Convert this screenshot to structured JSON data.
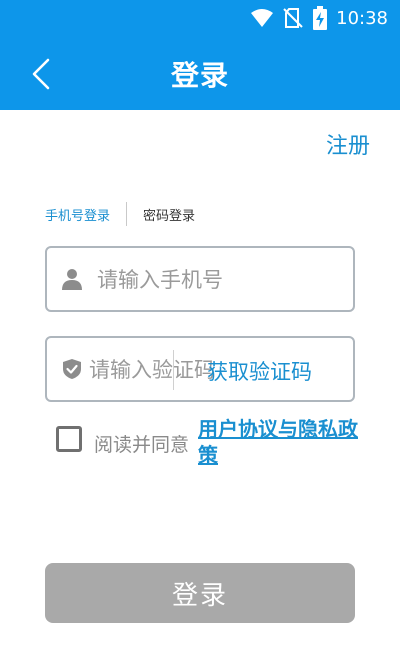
{
  "status_bar": {
    "time": "10:38",
    "icons": [
      "wifi-icon",
      "no-sim-icon",
      "battery-charging-icon"
    ]
  },
  "header": {
    "title": "登录",
    "back_icon": "chevron-left-icon"
  },
  "register_label": "注册",
  "tabs": [
    {
      "label": "手机号登录",
      "active": true
    },
    {
      "label": "密码登录",
      "active": false
    }
  ],
  "phone_field": {
    "placeholder": "请输入手机号",
    "value": "",
    "icon": "person-icon"
  },
  "code_field": {
    "placeholder": "请输入验证码",
    "value": "",
    "icon": "shield-check-icon",
    "get_code_label": "获取验证码"
  },
  "agreement": {
    "checked": false,
    "text": "阅读并同意",
    "link_text": "用户协议与隐私政策"
  },
  "login_button_label": "登录",
  "colors": {
    "primary": "#0d96ea",
    "link": "#1a8fd0",
    "button_disabled": "#a9a9a9",
    "border": "#aeb6bd"
  }
}
